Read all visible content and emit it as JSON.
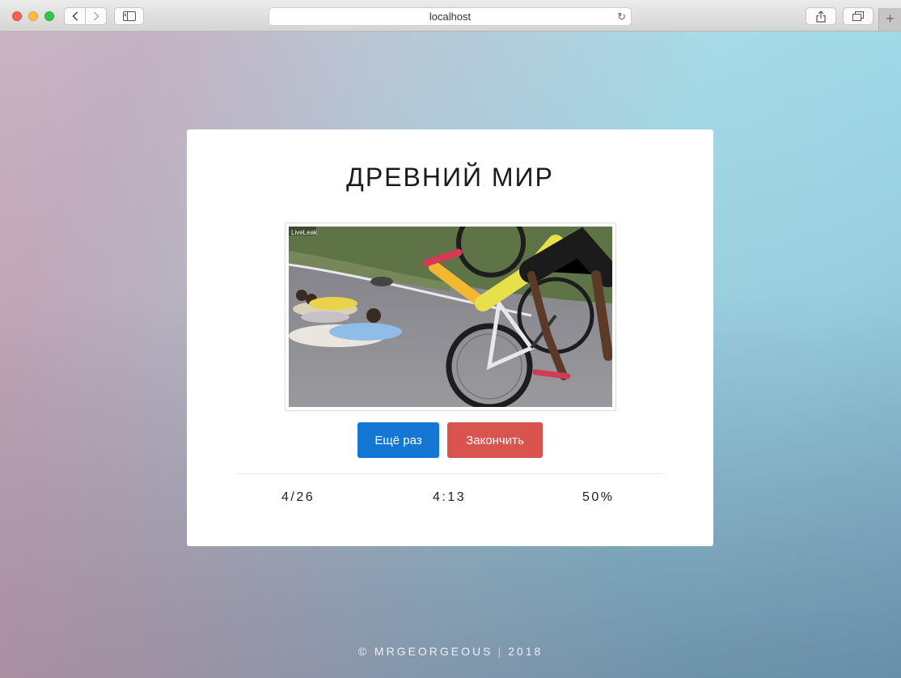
{
  "browser": {
    "url": "localhost",
    "new_tab_label": "+"
  },
  "quiz": {
    "title": "ДРЕВНИЙ МИР",
    "media": {
      "watermark": "LiveLeak"
    },
    "buttons": {
      "again_label": "Ещё раз",
      "finish_label": "Закончить"
    },
    "stats": {
      "progress": "4/26",
      "timer": "4:13",
      "score": "50%"
    }
  },
  "footer": {
    "copyright": "© MRGEORGEOUS",
    "separator": "|",
    "year": "2018"
  },
  "colors": {
    "again_button": "#1477d4",
    "finish_button": "#d9534f"
  }
}
